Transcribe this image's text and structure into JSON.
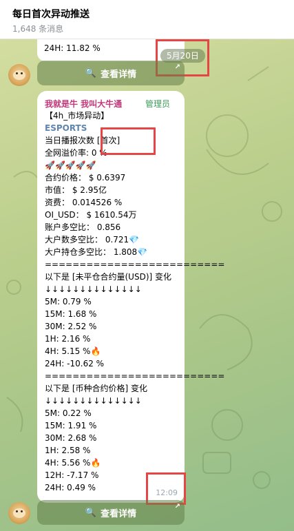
{
  "header": {
    "title": "每日首次异动推送",
    "subtitle": "1,648 条消息"
  },
  "prev_message": {
    "last_line": "24H:   11.82 %",
    "date_pill": "5月20日",
    "button_label": "查看详情"
  },
  "message": {
    "sender": "我就是牛 我叫大牛通",
    "badge": "管理员",
    "lines": [
      "【4h_市场异动】",
      "ESPORTS",
      "当日播报次数     [首次]",
      "全网溢价率:   0 %",
      "🚀🚀🚀🚀🚀",
      "合约价格：  $ 0.6397",
      "市值：  $ 2.95亿",
      "资费：  0.014526 %",
      "OI_USD：  $ 1610.54万",
      "账户多空比：  0.856",
      "大户数多空比：  0.721💎",
      "大户持仓多空比：  1.808💎",
      "==========================",
      "以下是 [未平仓合约量(USD)]  变化",
      "↓↓↓↓↓↓↓↓↓↓↓↓↓↓",
      "5M:   0.79 %",
      "15M:   1.68 %",
      "30M:   2.52 %",
      "1H:   2.16 %",
      "4H:   5.15 %🔥",
      "24H:   -10.62 %",
      "==========================",
      "以下是 [币种合约价格]  变化",
      "↓↓↓↓↓↓↓↓↓↓↓↓↓↓",
      "5M:   0.22 %",
      "15M:   1.91 %",
      "30M:   2.68 %",
      "1H:   2.58 %",
      "4H:   5.56 %🔥",
      "12H:   -7.17 %",
      "24H:   0.49 %"
    ],
    "time": "12:09",
    "button_label": "查看详情"
  },
  "icons": {
    "button_icon": "magnifier-icon",
    "button_corner": "expand-arrow-icon",
    "avatar": "doge-avatar"
  },
  "colors": {
    "sender": "#c0397a",
    "badge": "#3d9a5a",
    "tag": "#5f84ad",
    "highlight": "#e64545"
  }
}
